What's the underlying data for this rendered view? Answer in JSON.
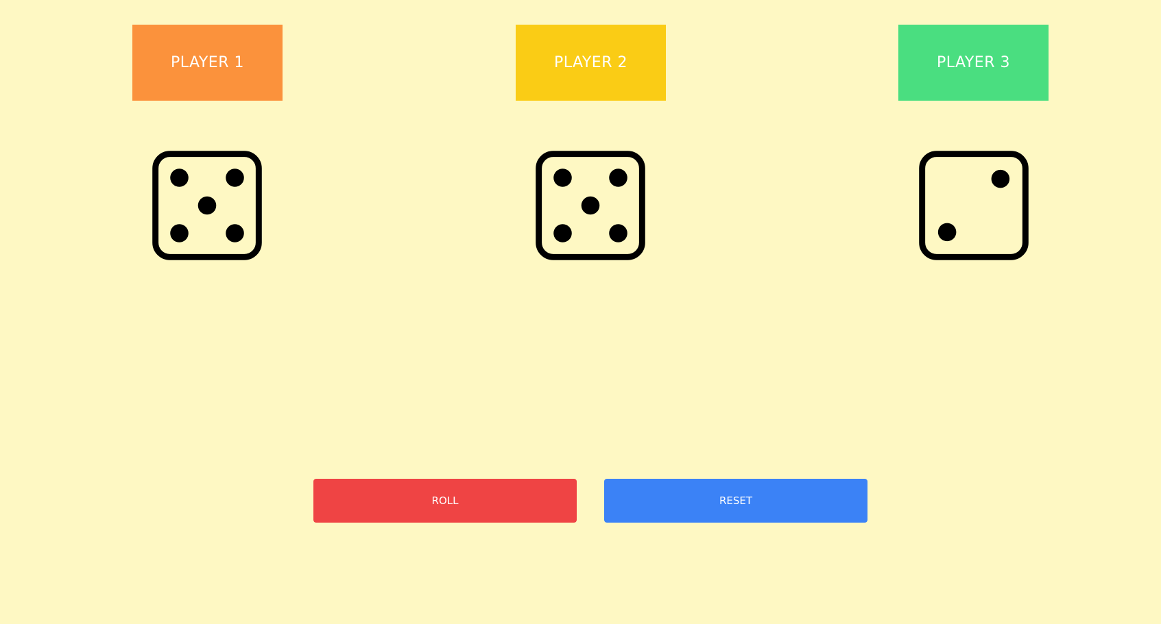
{
  "players": [
    {
      "label": "PLAYER 1",
      "color": "#fb923c",
      "die_value": 5,
      "die_icon": "dice-five-icon"
    },
    {
      "label": "PLAYER 2",
      "color": "#facc15",
      "die_value": 5,
      "die_icon": "dice-five-icon"
    },
    {
      "label": "PLAYER 3",
      "color": "#4ade80",
      "die_value": 2,
      "die_icon": "dice-two-icon"
    }
  ],
  "controls": {
    "roll_label": "ROLL",
    "roll_color": "#ef4444",
    "reset_label": "RESET",
    "reset_color": "#3b82f6"
  },
  "background_color": "#fef8c3"
}
